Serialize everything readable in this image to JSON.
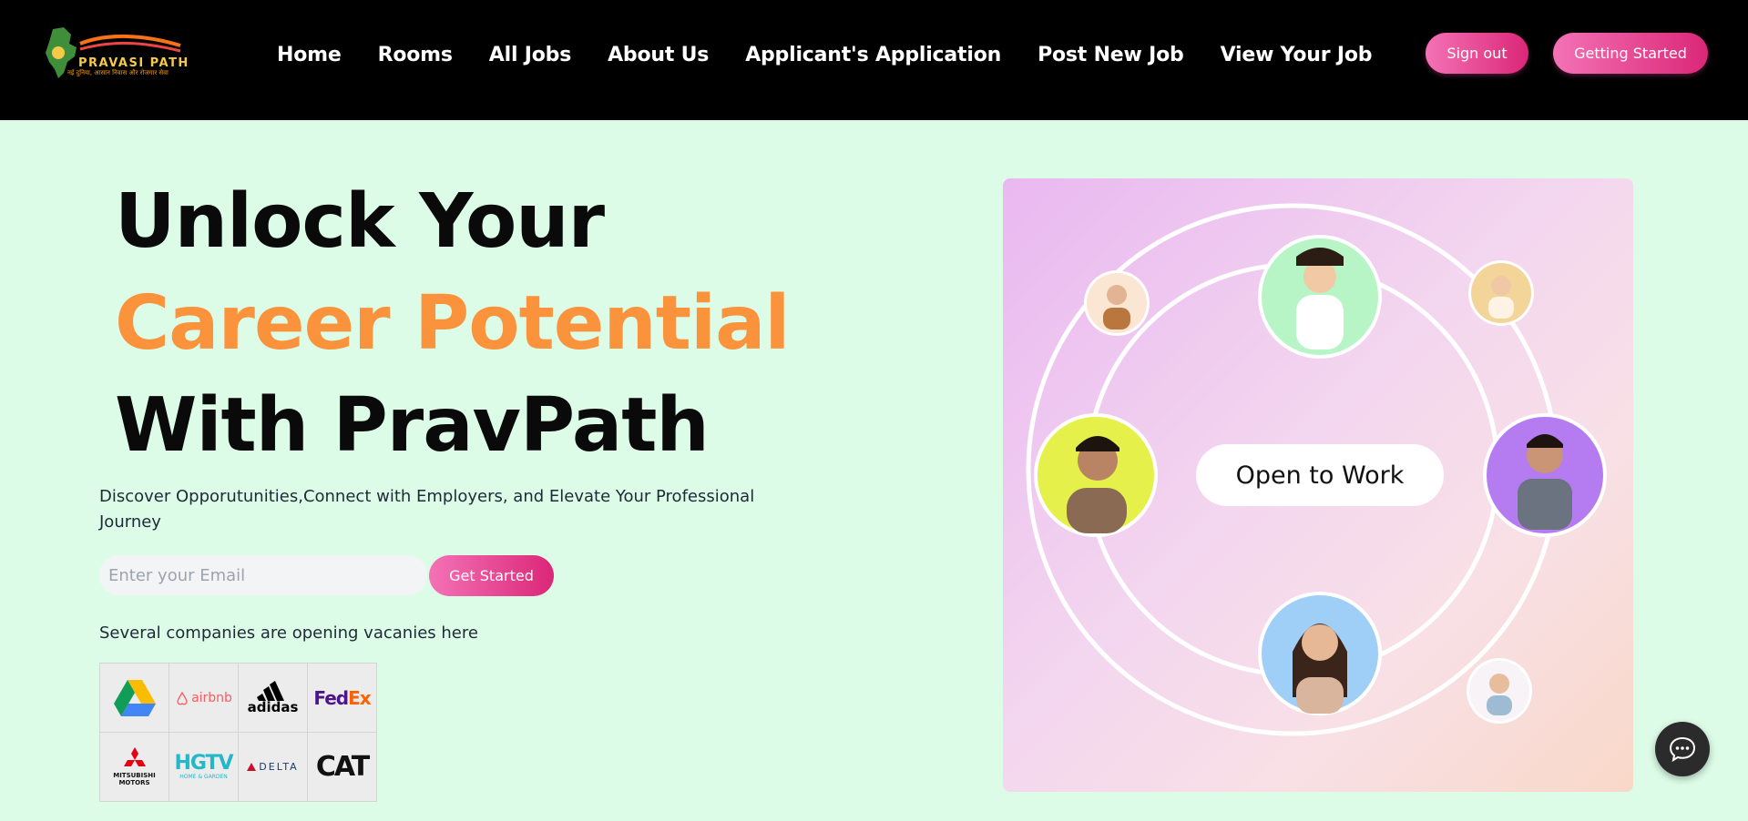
{
  "header": {
    "logo_text": "PRAVASI PATH",
    "logo_tagline": "नई दुनिया, आसान निवास और रोजगार सेवा",
    "nav": [
      "Home",
      "Rooms",
      "All Jobs",
      "About Us",
      "Applicant's Application",
      "Post New Job",
      "View Your Job"
    ],
    "sign_out_label": "Sign out",
    "getting_started_label": "Getting Started"
  },
  "hero": {
    "line1": "Unlock Your",
    "line2": "Career Potential",
    "line3": "With PravPath",
    "subtitle": "Discover Opporutunities,Connect with Employers, and Elevate Your Professional Journey",
    "email_placeholder": "Enter your Email",
    "get_started_label": "Get Started",
    "companies_text": "Several companies are opening vacanies here"
  },
  "companies": {
    "airbnb": "airbnb",
    "adidas": "adidas",
    "fedex_a": "Fed",
    "fedex_b": "Ex",
    "mitsubishi": "MITSUBISHI MOTORS",
    "hgtv": "HGTV",
    "hgtv_sub": "HOME & GARDEN",
    "delta": "DELTA",
    "cat": "CAT"
  },
  "illustration": {
    "center_label": "Open to Work"
  },
  "colors": {
    "background": "#dcfce7",
    "header": "#000000",
    "accent_pink": "#ec4899",
    "accent_orange": "#fb923c"
  }
}
